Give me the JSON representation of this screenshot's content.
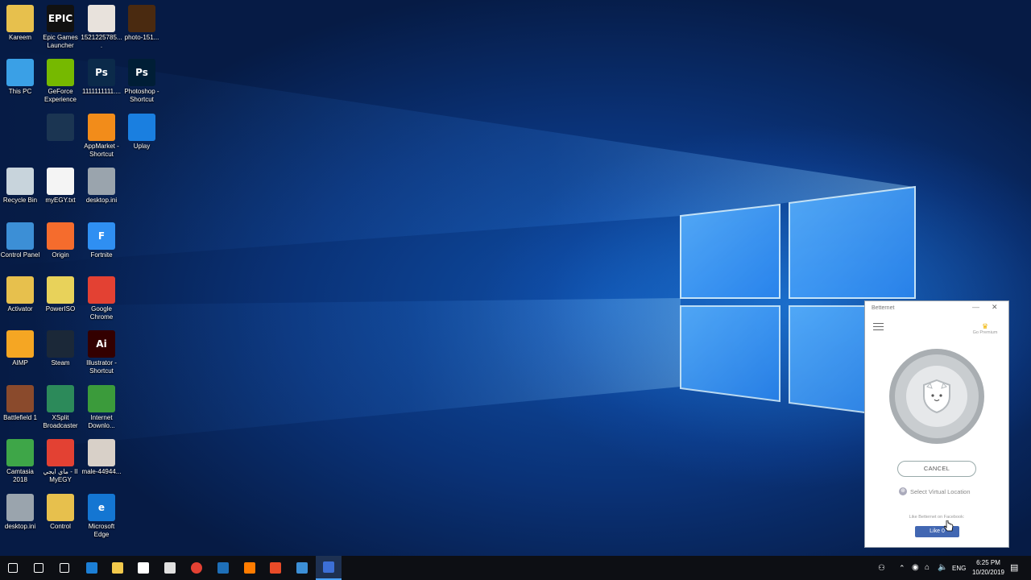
{
  "desktop": {
    "icons": [
      {
        "label": "Kareem",
        "icon": "folder-user-icon",
        "color": "#e7c04d"
      },
      {
        "label": "Epic Games Launcher",
        "icon": "epic-games-icon",
        "color": "#111111",
        "glyph": "EPIC"
      },
      {
        "label": "1521225785....",
        "icon": "image-thumbnail-icon",
        "color": "#e8e2dc"
      },
      {
        "label": "photo-151...",
        "icon": "photo-thumbnail-icon",
        "color": "#4a2a10"
      },
      {
        "label": "This PC",
        "icon": "computer-icon",
        "color": "#3aa0e6"
      },
      {
        "label": "GeForce Experience",
        "icon": "nvidia-icon",
        "color": "#76b900"
      },
      {
        "label": "1111111111....",
        "icon": "psd-file-icon",
        "color": "#0b2a4a",
        "glyph": "Ps"
      },
      {
        "label": "Photoshop - Shortcut",
        "icon": "photoshop-icon",
        "color": "#001e36",
        "glyph": "Ps"
      },
      {
        "label": "",
        "icon": "blank-tile-icon",
        "color": "#1b3552"
      },
      {
        "label": "AppMarket - Shortcut",
        "icon": "appmarket-icon",
        "color": "#f28c1a"
      },
      {
        "label": "Uplay",
        "icon": "uplay-icon",
        "color": "#1a7fe0"
      },
      {
        "label": "Recycle Bin",
        "icon": "recycle-bin-icon",
        "color": "#c8d4dc"
      },
      {
        "label": "myEGY.txt",
        "icon": "text-file-icon",
        "color": "#f4f4f4"
      },
      {
        "label": "desktop.ini",
        "icon": "settings-file-icon",
        "color": "#9aa4ad"
      },
      {
        "label": "Control Panel",
        "icon": "control-panel-icon",
        "color": "#3c8fd6"
      },
      {
        "label": "Origin",
        "icon": "origin-icon",
        "color": "#f56c2d"
      },
      {
        "label": "Fortnite",
        "icon": "fortnite-icon",
        "color": "#2f8ff2",
        "glyph": "F"
      },
      {
        "label": "Activator",
        "icon": "folder-icon",
        "color": "#e7c04d"
      },
      {
        "label": "PowerISO",
        "icon": "poweriso-icon",
        "color": "#e8d25a"
      },
      {
        "label": "Google Chrome",
        "icon": "chrome-icon",
        "color": "#e34133"
      },
      {
        "label": "AIMP",
        "icon": "aimp-icon",
        "color": "#f5a623"
      },
      {
        "label": "Steam",
        "icon": "steam-icon",
        "color": "#1b2838"
      },
      {
        "label": "Illustrator - Shortcut",
        "icon": "illustrator-icon",
        "color": "#330000",
        "glyph": "Ai"
      },
      {
        "label": "Battlefield 1",
        "icon": "battlefield-icon",
        "color": "#8a4a2c"
      },
      {
        "label": "XSplit Broadcaster",
        "icon": "xsplit-icon",
        "color": "#2c8a5a"
      },
      {
        "label": "Internet Downlo...",
        "icon": "idm-icon",
        "color": "#3b9b3b"
      },
      {
        "label": "Camtasia 2018",
        "icon": "camtasia-icon",
        "color": "#3ea648"
      },
      {
        "label": "ماي ايجي - II MyEGY",
        "icon": "chrome-icon",
        "color": "#e34133"
      },
      {
        "label": "male-44944...",
        "icon": "photo-thumbnail-icon",
        "color": "#d8d0c8"
      },
      {
        "label": "desktop.ini",
        "icon": "settings-file-icon",
        "color": "#9aa4ad"
      },
      {
        "label": "Control",
        "icon": "folder-icon",
        "color": "#e7c04d"
      },
      {
        "label": "Microsoft Edge",
        "icon": "edge-icon",
        "color": "#1476d2",
        "glyph": "e"
      }
    ]
  },
  "betternet": {
    "title": "Betternet",
    "minimize": "—",
    "close": "✕",
    "premium_crown": "♛",
    "go_premium": "Go Premium",
    "cancel_label": "CANCEL",
    "globe": "⊕",
    "select_location": "Select Virtual Location",
    "facebook_text": "Like Betternet on Facebook:",
    "like_label": "Like 0"
  },
  "taskbar": {
    "language": "ENG",
    "time": "6:25 PM",
    "date": "10/20/2019",
    "items": [
      {
        "icon": "start-windows-icon"
      },
      {
        "icon": "search-icon"
      },
      {
        "icon": "task-view-icon"
      },
      {
        "icon": "edge-icon"
      },
      {
        "icon": "file-explorer-icon"
      },
      {
        "icon": "store-icon"
      },
      {
        "icon": "mail-icon"
      },
      {
        "icon": "chrome-icon"
      },
      {
        "icon": "photoshop-icon"
      },
      {
        "icon": "illustrator-icon"
      },
      {
        "icon": "camtasia-icon"
      },
      {
        "icon": "control-panel-icon"
      },
      {
        "icon": "betternet-icon"
      }
    ]
  },
  "colors": {
    "taskbar_bg": "#0d0f14",
    "accent": "#4aa3ff",
    "facebook_blue": "#4267b2"
  }
}
